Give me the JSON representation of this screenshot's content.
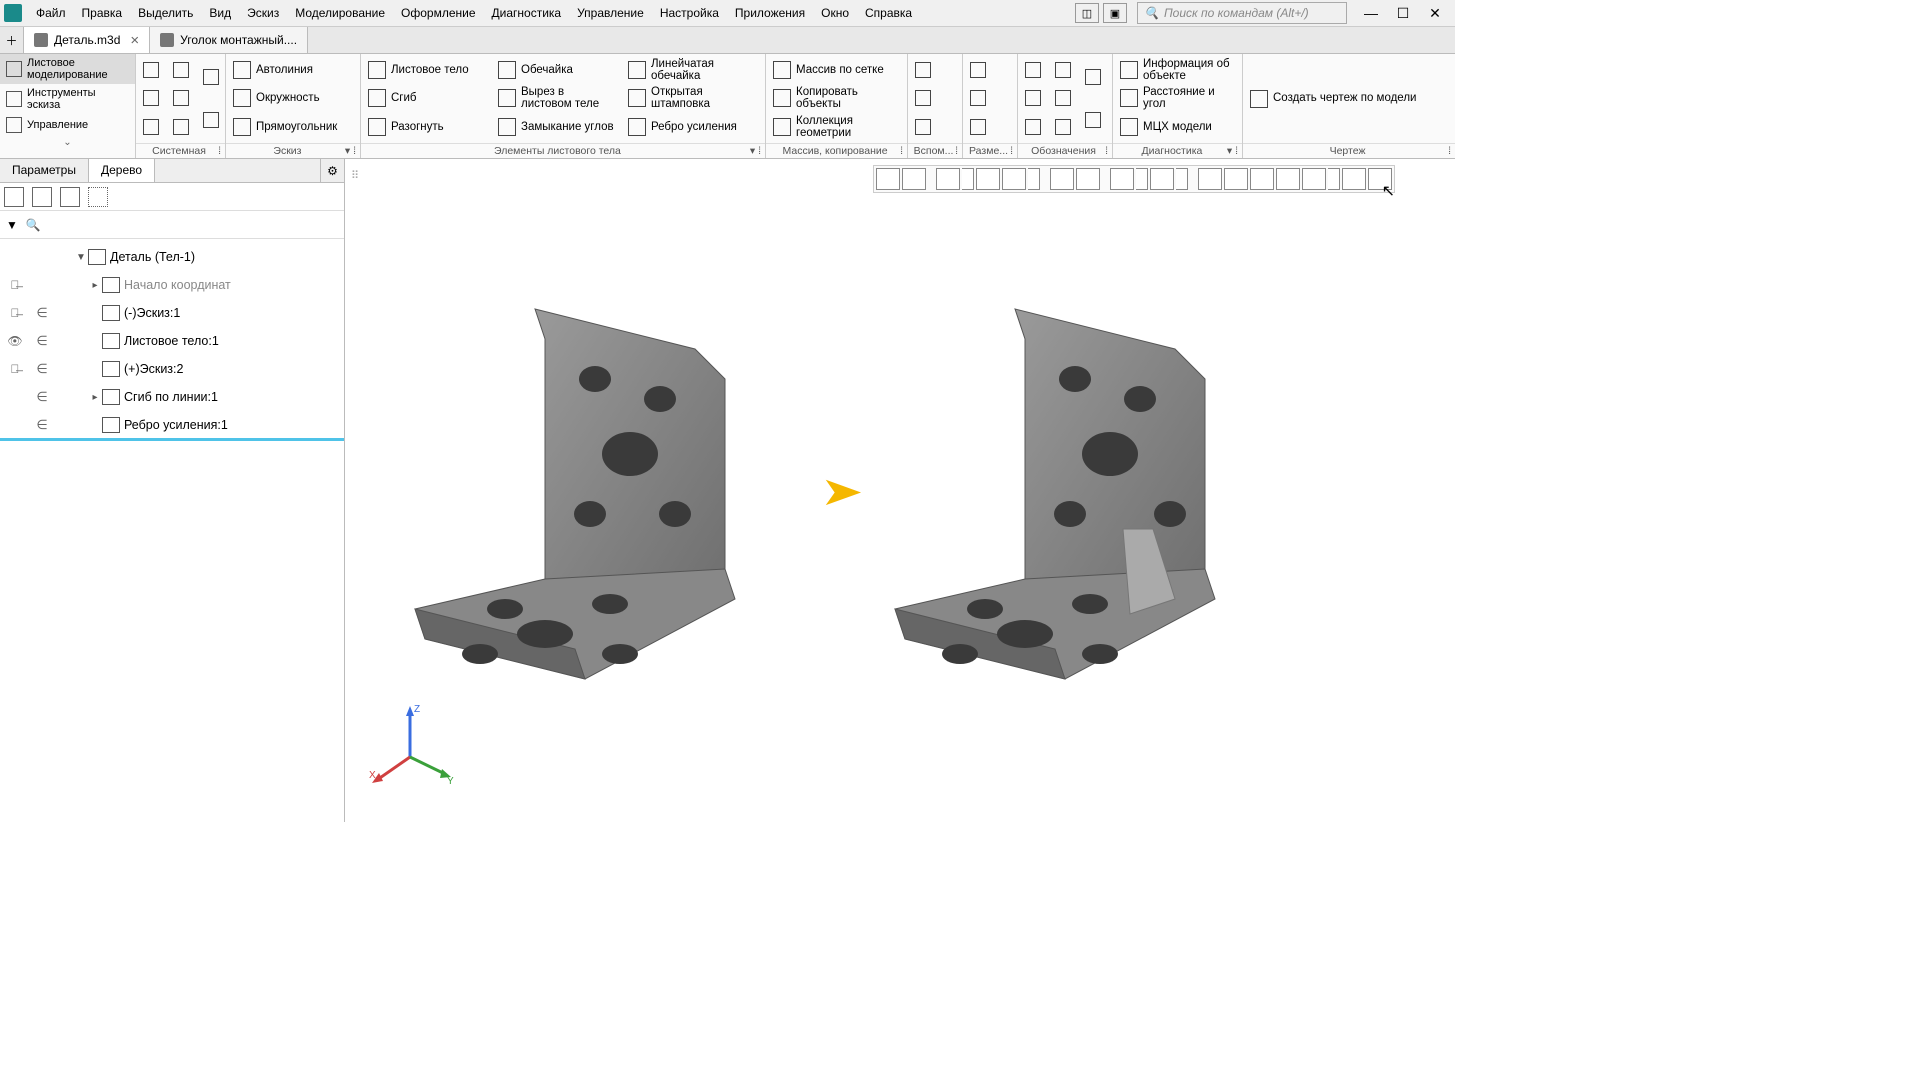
{
  "menu": {
    "items": [
      "Файл",
      "Правка",
      "Выделить",
      "Вид",
      "Эскиз",
      "Моделирование",
      "Оформление",
      "Диагностика",
      "Управление",
      "Настройка",
      "Приложения",
      "Окно",
      "Справка"
    ],
    "search_placeholder": "Поиск по командам (Alt+/)"
  },
  "tabs": {
    "active": "Деталь.m3d",
    "inactive": "Уголок монтажный...."
  },
  "ribbon_left": {
    "item0": "Листовое моделирование",
    "item1": "Инструменты эскиза",
    "item2": "Управление"
  },
  "ribbon": {
    "g_system": "Системная",
    "g_sketch": "Эскиз",
    "sketch_autoline": "Автолиния",
    "sketch_circle": "Окружность",
    "sketch_rect": "Прямоугольник",
    "g_sheet": "Элементы листового тела",
    "sheet_body": "Листовое тело",
    "sheet_bend": "Сгиб",
    "sheet_unbend": "Разогнуть",
    "sheet_shell": "Обечайка",
    "sheet_cut": "Вырез в листовом теле",
    "sheet_close": "Замыкание углов",
    "sheet_ruled": "Линейчатая обечайка",
    "sheet_stamp": "Открытая штамповка",
    "sheet_rib": "Ребро усиления",
    "g_array": "Массив, копирование",
    "arr_grid": "Массив по сетке",
    "arr_copy": "Копировать объекты",
    "arr_geom": "Коллекция геометрии",
    "g_aux": "Вспом...",
    "g_dim": "Разме...",
    "g_annot": "Обозначения",
    "g_diag": "Диагностика",
    "diag_info": "Информация об объекте",
    "diag_dist": "Расстояние и угол",
    "diag_mass": "МЦХ модели",
    "g_draw": "Чертеж",
    "draw_create": "Создать чертеж по модели"
  },
  "side": {
    "tab_params": "Параметры",
    "tab_tree": "Дерево"
  },
  "tree": {
    "root": "Деталь (Тел-1)",
    "origin": "Начало координат",
    "sketch1": "(-)Эскиз:1",
    "body1": "Листовое тело:1",
    "sketch2": "(+)Эскиз:2",
    "bend1": "Сгиб по линии:1",
    "rib1": "Ребро усиления:1"
  },
  "axis": {
    "x": "X",
    "y": "Y",
    "z": "Z"
  }
}
